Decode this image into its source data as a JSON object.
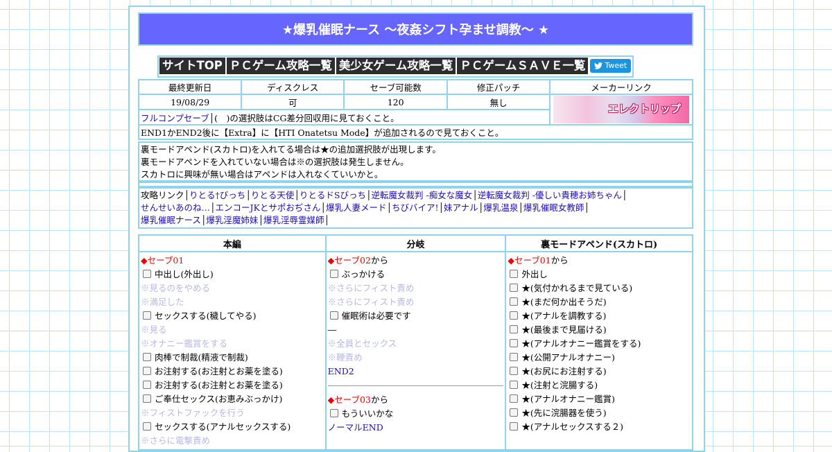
{
  "title": "★爆乳催眠ナース ～夜姦シフト孕ませ調教～ ★",
  "nav": [
    "サイトTOP",
    "ＰＣゲーム攻略一覧",
    "美少女ゲーム攻略一覧",
    "ＰＣゲームＳＡＶＥ一覧"
  ],
  "tweet": "Tweet",
  "info": {
    "headers": [
      "最終更新日",
      "ディスクレス",
      "セーブ可能数",
      "修正パッチ",
      "メーカーリンク"
    ],
    "values": [
      "19/08/29",
      "可",
      "120",
      "無し"
    ],
    "maker_logo": "エレクトリップ",
    "fullcomp_link": "フルコンプセーブ",
    "fullcomp_note": "│(　)の選択肢はCG差分回収用に見ておくこと。",
    "extra_note": "END1かEND2後に【Extra】に【HTI Onatetsu Mode】が追加されるので見ておくこと。"
  },
  "notes": [
    "裏モードアペンド(スカトロ)を入れてる場合は★の追加選択肢が出現します。",
    "裏モードアペンドを入れていない場合は※の選択肢は発生しません。",
    "スカトロに興味が無い場合はアペンドは入れなくていいかと。"
  ],
  "links_label": "攻略リンク",
  "links": [
    "りとる†びっち",
    "りとる天使",
    "りとるドSびっち",
    "逆転魔女裁判 -痴女な魔女",
    "逆転魔女裁判 -優しい貴穂お姉ちゃん",
    "せんせいあのね…",
    "エンコーJKとサポおぢさん",
    "爆乳人妻メード",
    "ちびバイア!",
    "妹アナル",
    "爆乳温泉",
    "爆乳催眠女教師",
    "爆乳催眠ナース",
    "爆乳淫魔姉妹",
    "爆乳淫辱霊媒師"
  ],
  "columns": {
    "headers": [
      "本編",
      "分岐",
      "裏モードアペンド(スカトロ)"
    ],
    "honpen": {
      "save": "セーブ01",
      "items": [
        {
          "t": "c",
          "v": "中出し(外出し)"
        },
        {
          "t": "f",
          "v": "※見るのをやめる"
        },
        {
          "t": "f",
          "v": "※満足した"
        },
        {
          "t": "c",
          "v": "セックスする(穢してやる)"
        },
        {
          "t": "f",
          "v": "※見る"
        },
        {
          "t": "f",
          "v": "※オナニー鑑賞をする"
        },
        {
          "t": "c",
          "v": "肉棒で制裁(精液で制裁)"
        },
        {
          "t": "c",
          "v": "お注射する(お注射とお薬を塗る)"
        },
        {
          "t": "c",
          "v": "お注射する(お注射とお薬を塗る)"
        },
        {
          "t": "c",
          "v": "ご奉仕セックス(お恵みぶっかけ)"
        },
        {
          "t": "f",
          "v": "※フィストファックを行う"
        },
        {
          "t": "c",
          "v": "セックスする(アナルセックスする)"
        },
        {
          "t": "f",
          "v": "※さらに電撃責め"
        }
      ]
    },
    "bunki": {
      "save1": "セーブ02",
      "from": "から",
      "items1": [
        {
          "t": "c",
          "v": "ぶっかける"
        },
        {
          "t": "f",
          "v": "※さらにフィスト責め"
        },
        {
          "t": "f",
          "v": "※さらにフィスト責め"
        },
        {
          "t": "c",
          "v": "催眠術は必要です"
        },
        {
          "t": "p",
          "v": "―"
        },
        {
          "t": "f",
          "v": "※全員とセックス"
        },
        {
          "t": "f",
          "v": "※鞭責め"
        },
        {
          "t": "l",
          "v": "END2"
        }
      ],
      "save2": "セーブ03",
      "items2": [
        {
          "t": "c",
          "v": "もういいかな"
        },
        {
          "t": "l",
          "v": "ノーマルEND"
        }
      ]
    },
    "ura": {
      "save": "セーブ01",
      "from": "から",
      "items": [
        "外出し",
        "★(気付かれるまで見ている)",
        "★(まだ何か出そうだ)",
        "★(アナルを調教する)",
        "★(最後まで見届ける)",
        "★(アナルオナニー鑑賞をする)",
        "★(公開アナルオナニー)",
        "★(お尻にお注射する)",
        "★(注射と浣腸する)",
        "★(アナルオナニー鑑賞)",
        "★(先に浣腸器を使う)",
        "★(アナルセックスする２)"
      ]
    }
  }
}
